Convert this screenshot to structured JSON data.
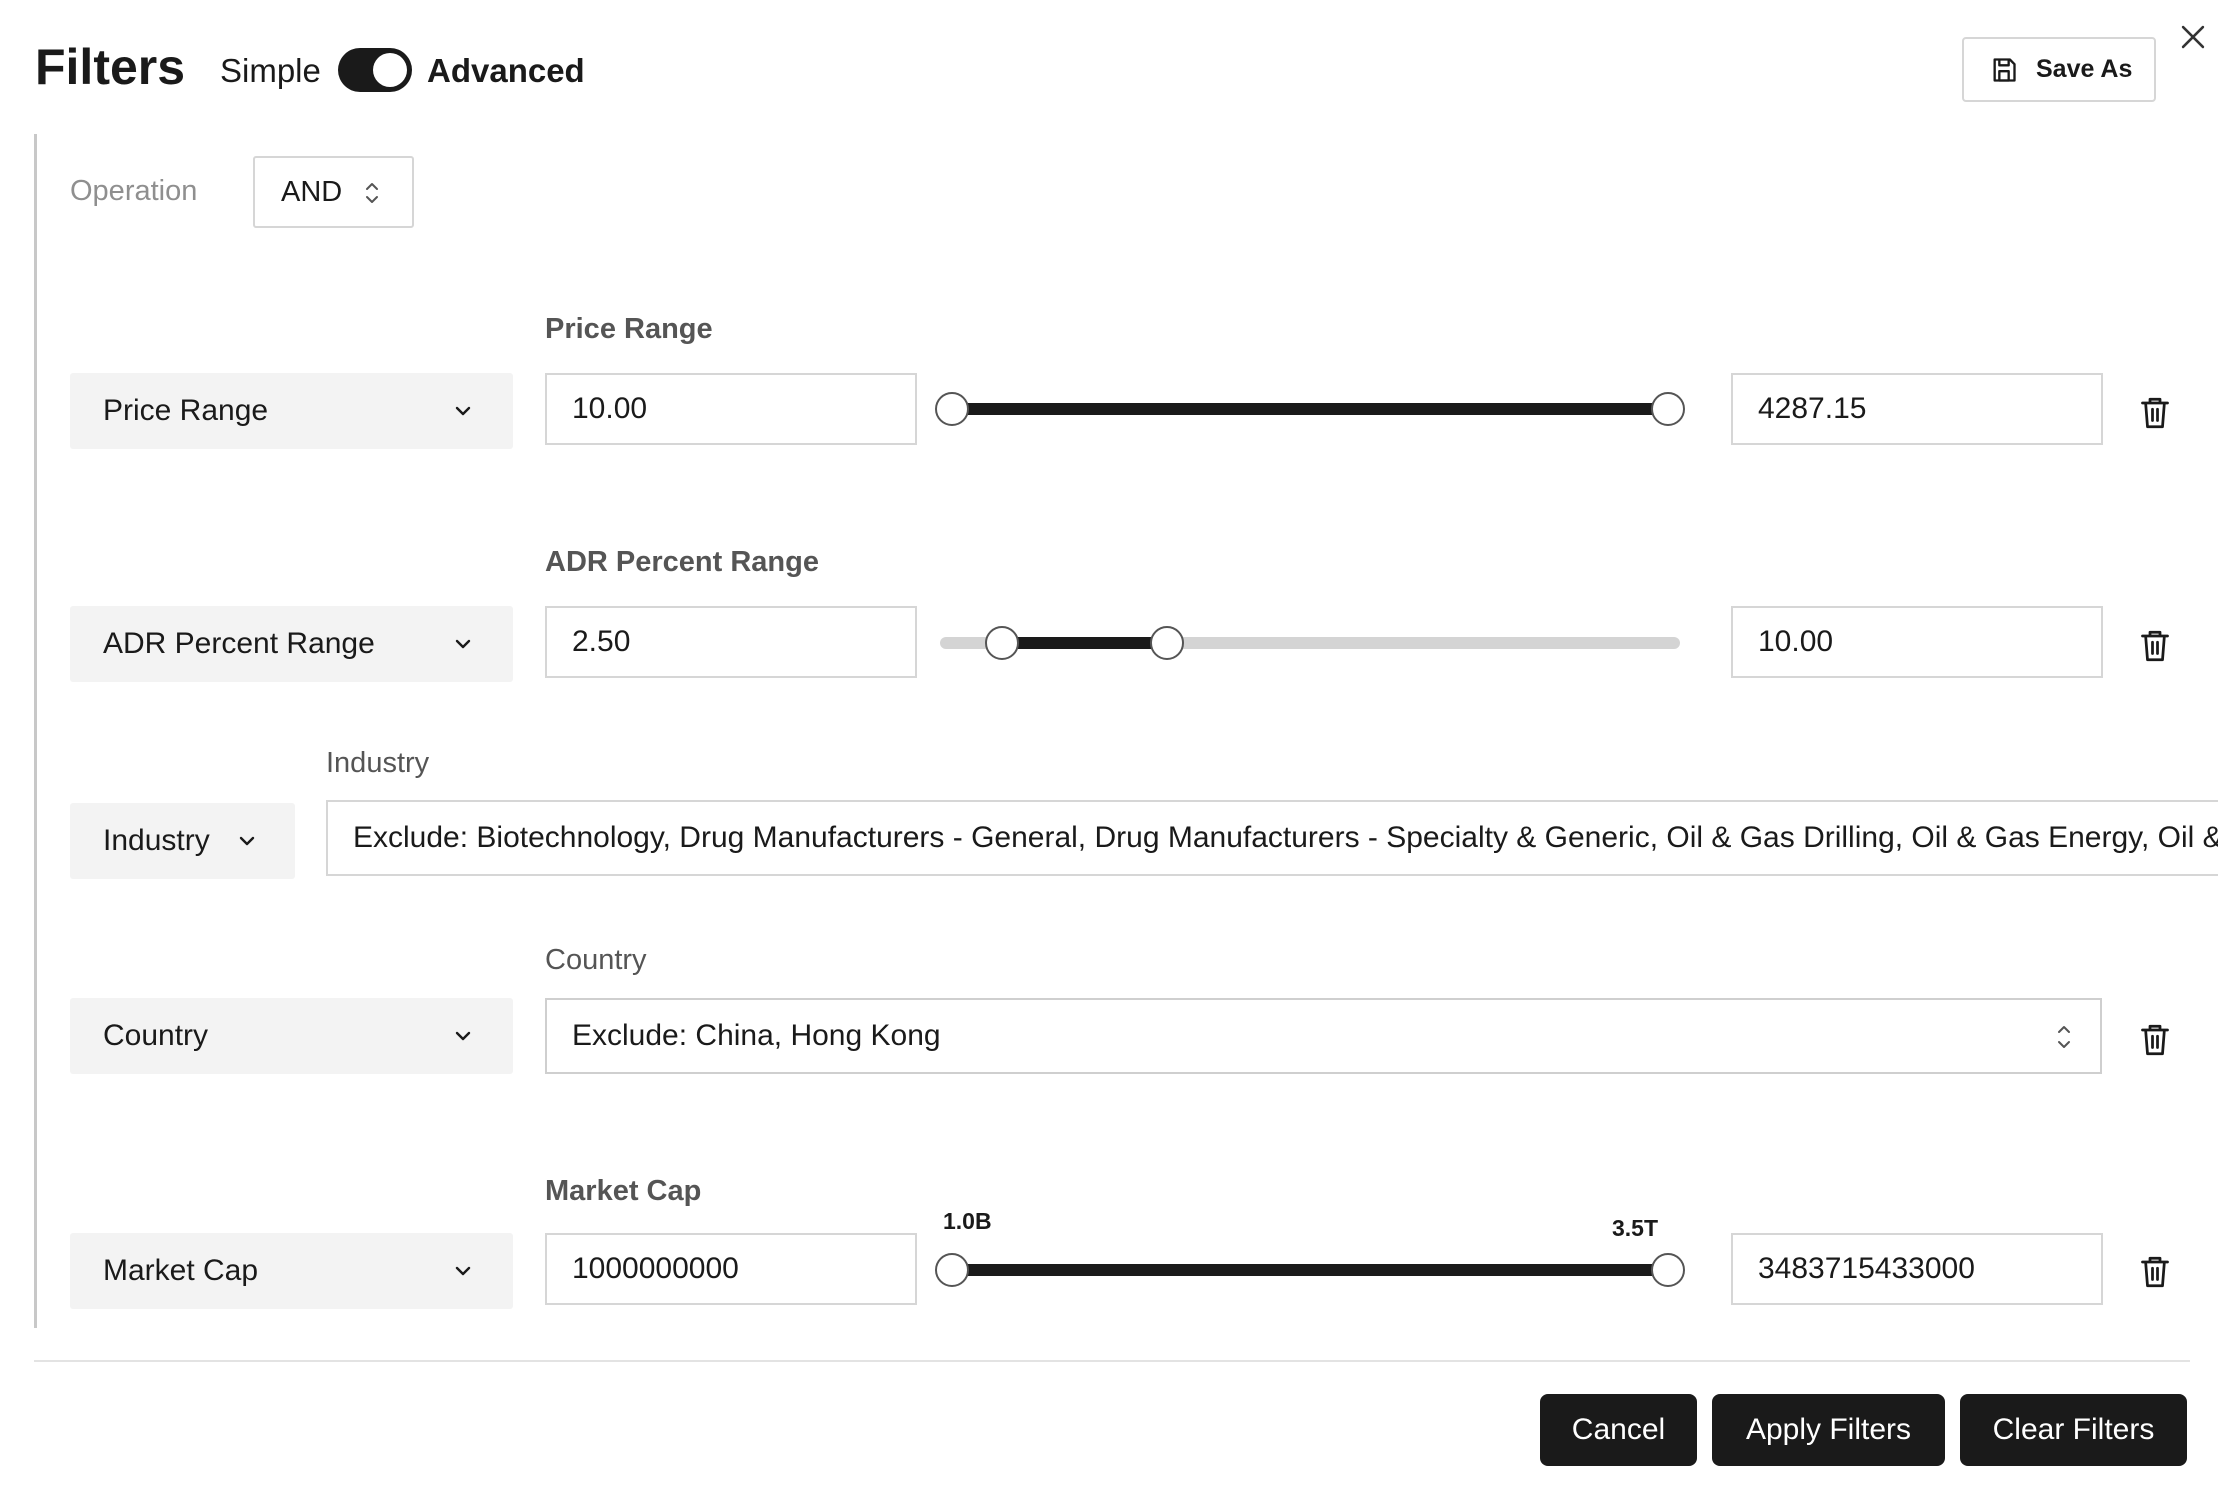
{
  "header": {
    "title": "Filters",
    "mode_simple": "Simple",
    "mode_advanced": "Advanced",
    "mode_toggle_on": true,
    "save_as_label": "Save As"
  },
  "operation": {
    "label": "Operation",
    "value": "AND"
  },
  "rows": {
    "price": {
      "dropdown": "Price Range",
      "label": "Price Range",
      "min_value": "10.00",
      "max_value": "4287.15",
      "slider_low_fraction": 0.0,
      "slider_high_fraction": 1.0
    },
    "adr": {
      "dropdown": "ADR Percent Range",
      "label": "ADR Percent Range",
      "min_value": "2.50",
      "max_value": "10.00",
      "slider_low_fraction": 0.07,
      "slider_high_fraction": 0.3
    },
    "industry": {
      "dropdown": "Industry",
      "label": "Industry",
      "value": "Exclude: Biotechnology, Drug Manufacturers - General, Drug Manufacturers - Specialty & Generic, Oil & Gas Drilling, Oil & Gas Energy, Oil & "
    },
    "country": {
      "dropdown": "Country",
      "label": "Country",
      "value": "Exclude: China, Hong Kong"
    },
    "market_cap": {
      "dropdown": "Market Cap",
      "label": "Market Cap",
      "min_value": "1000000000",
      "max_value": "3483715433000",
      "slider_min_tick": "1.0B",
      "slider_max_tick": "3.5T",
      "slider_low_fraction": 0.0,
      "slider_high_fraction": 1.0
    }
  },
  "footer": {
    "cancel_label": "Cancel",
    "apply_label": "Apply Filters",
    "clear_label": "Clear Filters"
  },
  "icons": {
    "close": "close-icon",
    "save": "floppy-disk-icon",
    "trash": "trash-icon",
    "chevron": "chevron-down-icon",
    "updown": "up-down-chevron-icon"
  },
  "colors": {
    "primary": "#1a1a1a",
    "track": "#d4d4d4",
    "dropdown_bg": "#f3f3f3",
    "muted_label": "#8f8f8f"
  }
}
